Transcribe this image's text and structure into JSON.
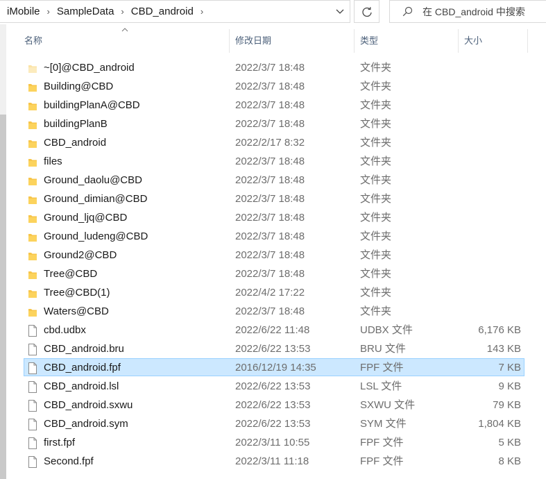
{
  "address": {
    "crumbs": [
      "iMobile",
      "SampleData",
      "CBD_android"
    ],
    "separator": "›"
  },
  "search": {
    "placeholder": "在 CBD_android 中搜索"
  },
  "columns": {
    "name": "名称",
    "date": "修改日期",
    "type": "类型",
    "size": "大小"
  },
  "colors": {
    "folder": "#f7c54a",
    "selected_bg": "#cce8ff",
    "selected_border": "#99d1ff"
  },
  "files": [
    {
      "name": "~[0]@CBD_android",
      "date": "2022/3/7 18:48",
      "type": "文件夹",
      "size": "",
      "icon": "folder-icon",
      "faded": true
    },
    {
      "name": "Building@CBD",
      "date": "2022/3/7 18:48",
      "type": "文件夹",
      "size": "",
      "icon": "folder-icon"
    },
    {
      "name": "buildingPlanA@CBD",
      "date": "2022/3/7 18:48",
      "type": "文件夹",
      "size": "",
      "icon": "folder-icon"
    },
    {
      "name": "buildingPlanB",
      "date": "2022/3/7 18:48",
      "type": "文件夹",
      "size": "",
      "icon": "folder-icon"
    },
    {
      "name": "CBD_android",
      "date": "2022/2/17 8:32",
      "type": "文件夹",
      "size": "",
      "icon": "folder-icon"
    },
    {
      "name": "files",
      "date": "2022/3/7 18:48",
      "type": "文件夹",
      "size": "",
      "icon": "folder-icon"
    },
    {
      "name": "Ground_daolu@CBD",
      "date": "2022/3/7 18:48",
      "type": "文件夹",
      "size": "",
      "icon": "folder-icon"
    },
    {
      "name": "Ground_dimian@CBD",
      "date": "2022/3/7 18:48",
      "type": "文件夹",
      "size": "",
      "icon": "folder-icon"
    },
    {
      "name": "Ground_ljq@CBD",
      "date": "2022/3/7 18:48",
      "type": "文件夹",
      "size": "",
      "icon": "folder-icon"
    },
    {
      "name": "Ground_ludeng@CBD",
      "date": "2022/3/7 18:48",
      "type": "文件夹",
      "size": "",
      "icon": "folder-icon"
    },
    {
      "name": "Ground2@CBD",
      "date": "2022/3/7 18:48",
      "type": "文件夹",
      "size": "",
      "icon": "folder-icon"
    },
    {
      "name": "Tree@CBD",
      "date": "2022/3/7 18:48",
      "type": "文件夹",
      "size": "",
      "icon": "folder-icon"
    },
    {
      "name": "Tree@CBD(1)",
      "date": "2022/4/2 17:22",
      "type": "文件夹",
      "size": "",
      "icon": "folder-icon"
    },
    {
      "name": "Waters@CBD",
      "date": "2022/3/7 18:48",
      "type": "文件夹",
      "size": "",
      "icon": "folder-icon"
    },
    {
      "name": "cbd.udbx",
      "date": "2022/6/22 11:48",
      "type": "UDBX 文件",
      "size": "6,176 KB",
      "icon": "file-icon"
    },
    {
      "name": "CBD_android.bru",
      "date": "2022/6/22 13:53",
      "type": "BRU 文件",
      "size": "143 KB",
      "icon": "file-icon"
    },
    {
      "name": "CBD_android.fpf",
      "date": "2016/12/19 14:35",
      "type": "FPF 文件",
      "size": "7 KB",
      "icon": "file-icon",
      "selected": true
    },
    {
      "name": "CBD_android.lsl",
      "date": "2022/6/22 13:53",
      "type": "LSL 文件",
      "size": "9 KB",
      "icon": "file-icon"
    },
    {
      "name": "CBD_android.sxwu",
      "date": "2022/6/22 13:53",
      "type": "SXWU 文件",
      "size": "79 KB",
      "icon": "file-icon"
    },
    {
      "name": "CBD_android.sym",
      "date": "2022/6/22 13:53",
      "type": "SYM 文件",
      "size": "1,804 KB",
      "icon": "file-icon"
    },
    {
      "name": "first.fpf",
      "date": "2022/3/11 10:55",
      "type": "FPF 文件",
      "size": "5 KB",
      "icon": "file-icon"
    },
    {
      "name": "Second.fpf",
      "date": "2022/3/11 11:18",
      "type": "FPF 文件",
      "size": "8 KB",
      "icon": "file-icon"
    }
  ]
}
